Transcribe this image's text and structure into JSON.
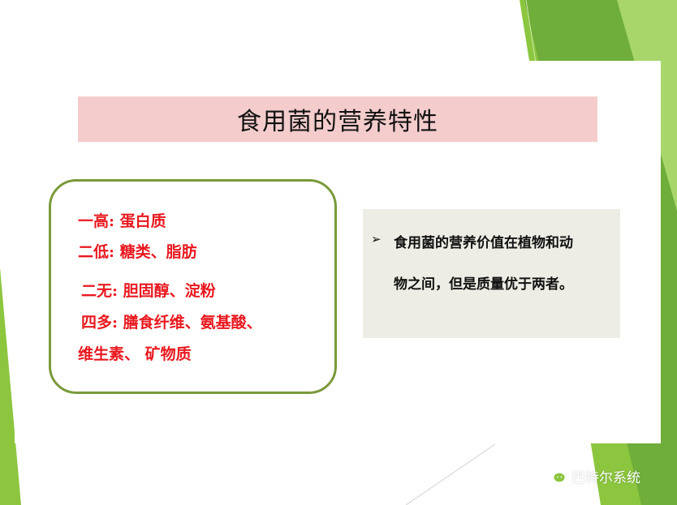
{
  "slide": {
    "title": "食用菌的营养特性",
    "nutrition_points": [
      "一高: 蛋白质",
      "二低: 糖类、脂肪",
      "二无: 胆固醇、淀粉",
      "四多: 膳食纤维、氨基酸、",
      "维生素、 矿物质"
    ],
    "note": {
      "bullet_icon": "arrow-bullet-icon",
      "lines": [
        "食用菌的营养价值在植物和动",
        "物之间，但是质量优于两者。"
      ]
    }
  },
  "watermark": {
    "icon": "wechat-icon",
    "text": "巴特尔系统"
  },
  "colors": {
    "title_bg": "#f4cccc",
    "box_border": "#7a9a3a",
    "point_text": "#e8191f",
    "note_bg": "#ededE5",
    "accent_green": "#8cc63f"
  }
}
